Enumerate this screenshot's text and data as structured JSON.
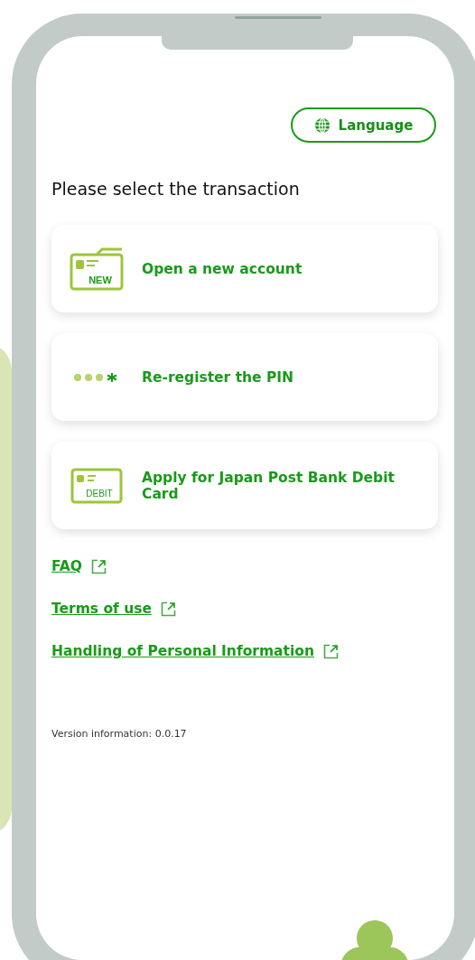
{
  "language_button": {
    "label": "Language"
  },
  "heading": "Please select the transaction",
  "options": [
    {
      "kind": "new",
      "label": "Open a new account",
      "badge": "NEW"
    },
    {
      "kind": "pin",
      "label": "Re-register the PIN"
    },
    {
      "kind": "debit",
      "label": "Apply for Japan Post Bank Debit Card",
      "badge": "DEBIT"
    }
  ],
  "links": [
    {
      "label": "FAQ"
    },
    {
      "label": "Terms of use"
    },
    {
      "label": "Handling of Personal Information"
    }
  ],
  "version": "Version information: 0.0.17"
}
